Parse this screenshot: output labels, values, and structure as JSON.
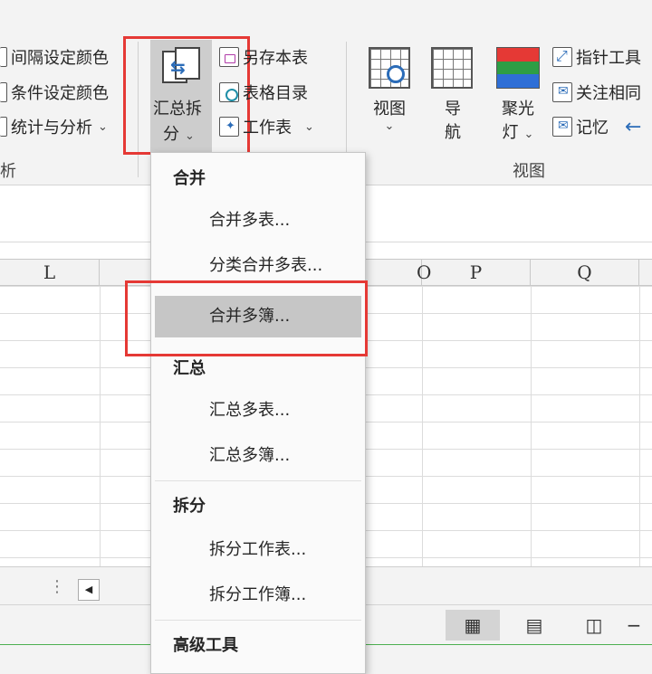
{
  "ribbon": {
    "left_group": {
      "items": [
        "间隔设定颜色",
        "条件设定颜色",
        "统计与分析"
      ],
      "label": "析"
    },
    "summary_split": {
      "label_line1": "汇总拆",
      "label_line2": "分"
    },
    "middle_items": [
      "另存本表",
      "表格目录",
      "工作表"
    ],
    "view_group": {
      "view_label": "视图",
      "nav_label_1": "导",
      "nav_label_2": "航",
      "spotlight_label_1": "聚光",
      "spotlight_label_2": "灯",
      "right_items": [
        "指针工具",
        "关注相同",
        "记忆"
      ],
      "group_label": "视图"
    },
    "caret": "⌄"
  },
  "columns": [
    "L",
    "",
    "O",
    "P",
    "Q"
  ],
  "dropdown": {
    "sections": [
      {
        "header": "合并",
        "items": [
          "合并多表...",
          "分类合并多表...",
          "合并多簿..."
        ]
      },
      {
        "header": "汇总",
        "items": [
          "汇总多表...",
          "汇总多簿..."
        ]
      },
      {
        "header": "拆分",
        "items": [
          "拆分工作表...",
          "拆分工作簿..."
        ]
      },
      {
        "header": "高级工具",
        "items": []
      }
    ],
    "hovered_item": "合并多簿..."
  },
  "status": {
    "view_buttons": [
      "normal-view",
      "page-layout-view",
      "page-break-view"
    ],
    "zoom_minus": "−"
  },
  "colors": {
    "highlight_red": "#e53935",
    "accent_blue": "#2b6cb8",
    "spotlight_red": "#e53935",
    "spotlight_green": "#2e9e45",
    "spotlight_blue": "#2f6fd6"
  }
}
